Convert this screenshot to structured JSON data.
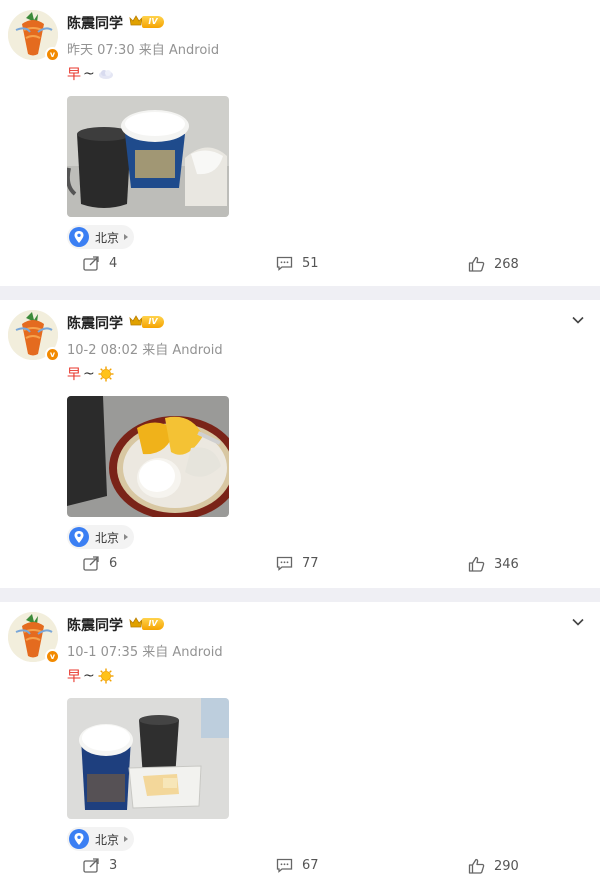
{
  "posts": [
    {
      "author": "陈震同学",
      "level": "IV",
      "time": "昨天 07:30",
      "source": "来自 Android",
      "text_main": "早",
      "text_tilde": "~",
      "emoji": "cloud-moon",
      "location": "北京",
      "reposts": "4",
      "comments": "51",
      "likes": "268",
      "has_menu": false
    },
    {
      "author": "陈震同学",
      "level": "IV",
      "time": "10-2 08:02",
      "source": "来自 Android",
      "text_main": "早",
      "text_tilde": "~",
      "emoji": "sun",
      "location": "北京",
      "reposts": "6",
      "comments": "77",
      "likes": "346",
      "has_menu": true
    },
    {
      "author": "陈震同学",
      "level": "IV",
      "time": "10-1 07:35",
      "source": "来自 Android",
      "text_main": "早",
      "text_tilde": "~",
      "emoji": "sun",
      "location": "北京",
      "reposts": "3",
      "comments": "67",
      "likes": "290",
      "has_menu": true
    }
  ],
  "colors": {
    "accent_red": "#e8372c",
    "badge_orange": "#f28a00",
    "location_blue": "#3b7ff3",
    "divider": "#efeff4"
  }
}
